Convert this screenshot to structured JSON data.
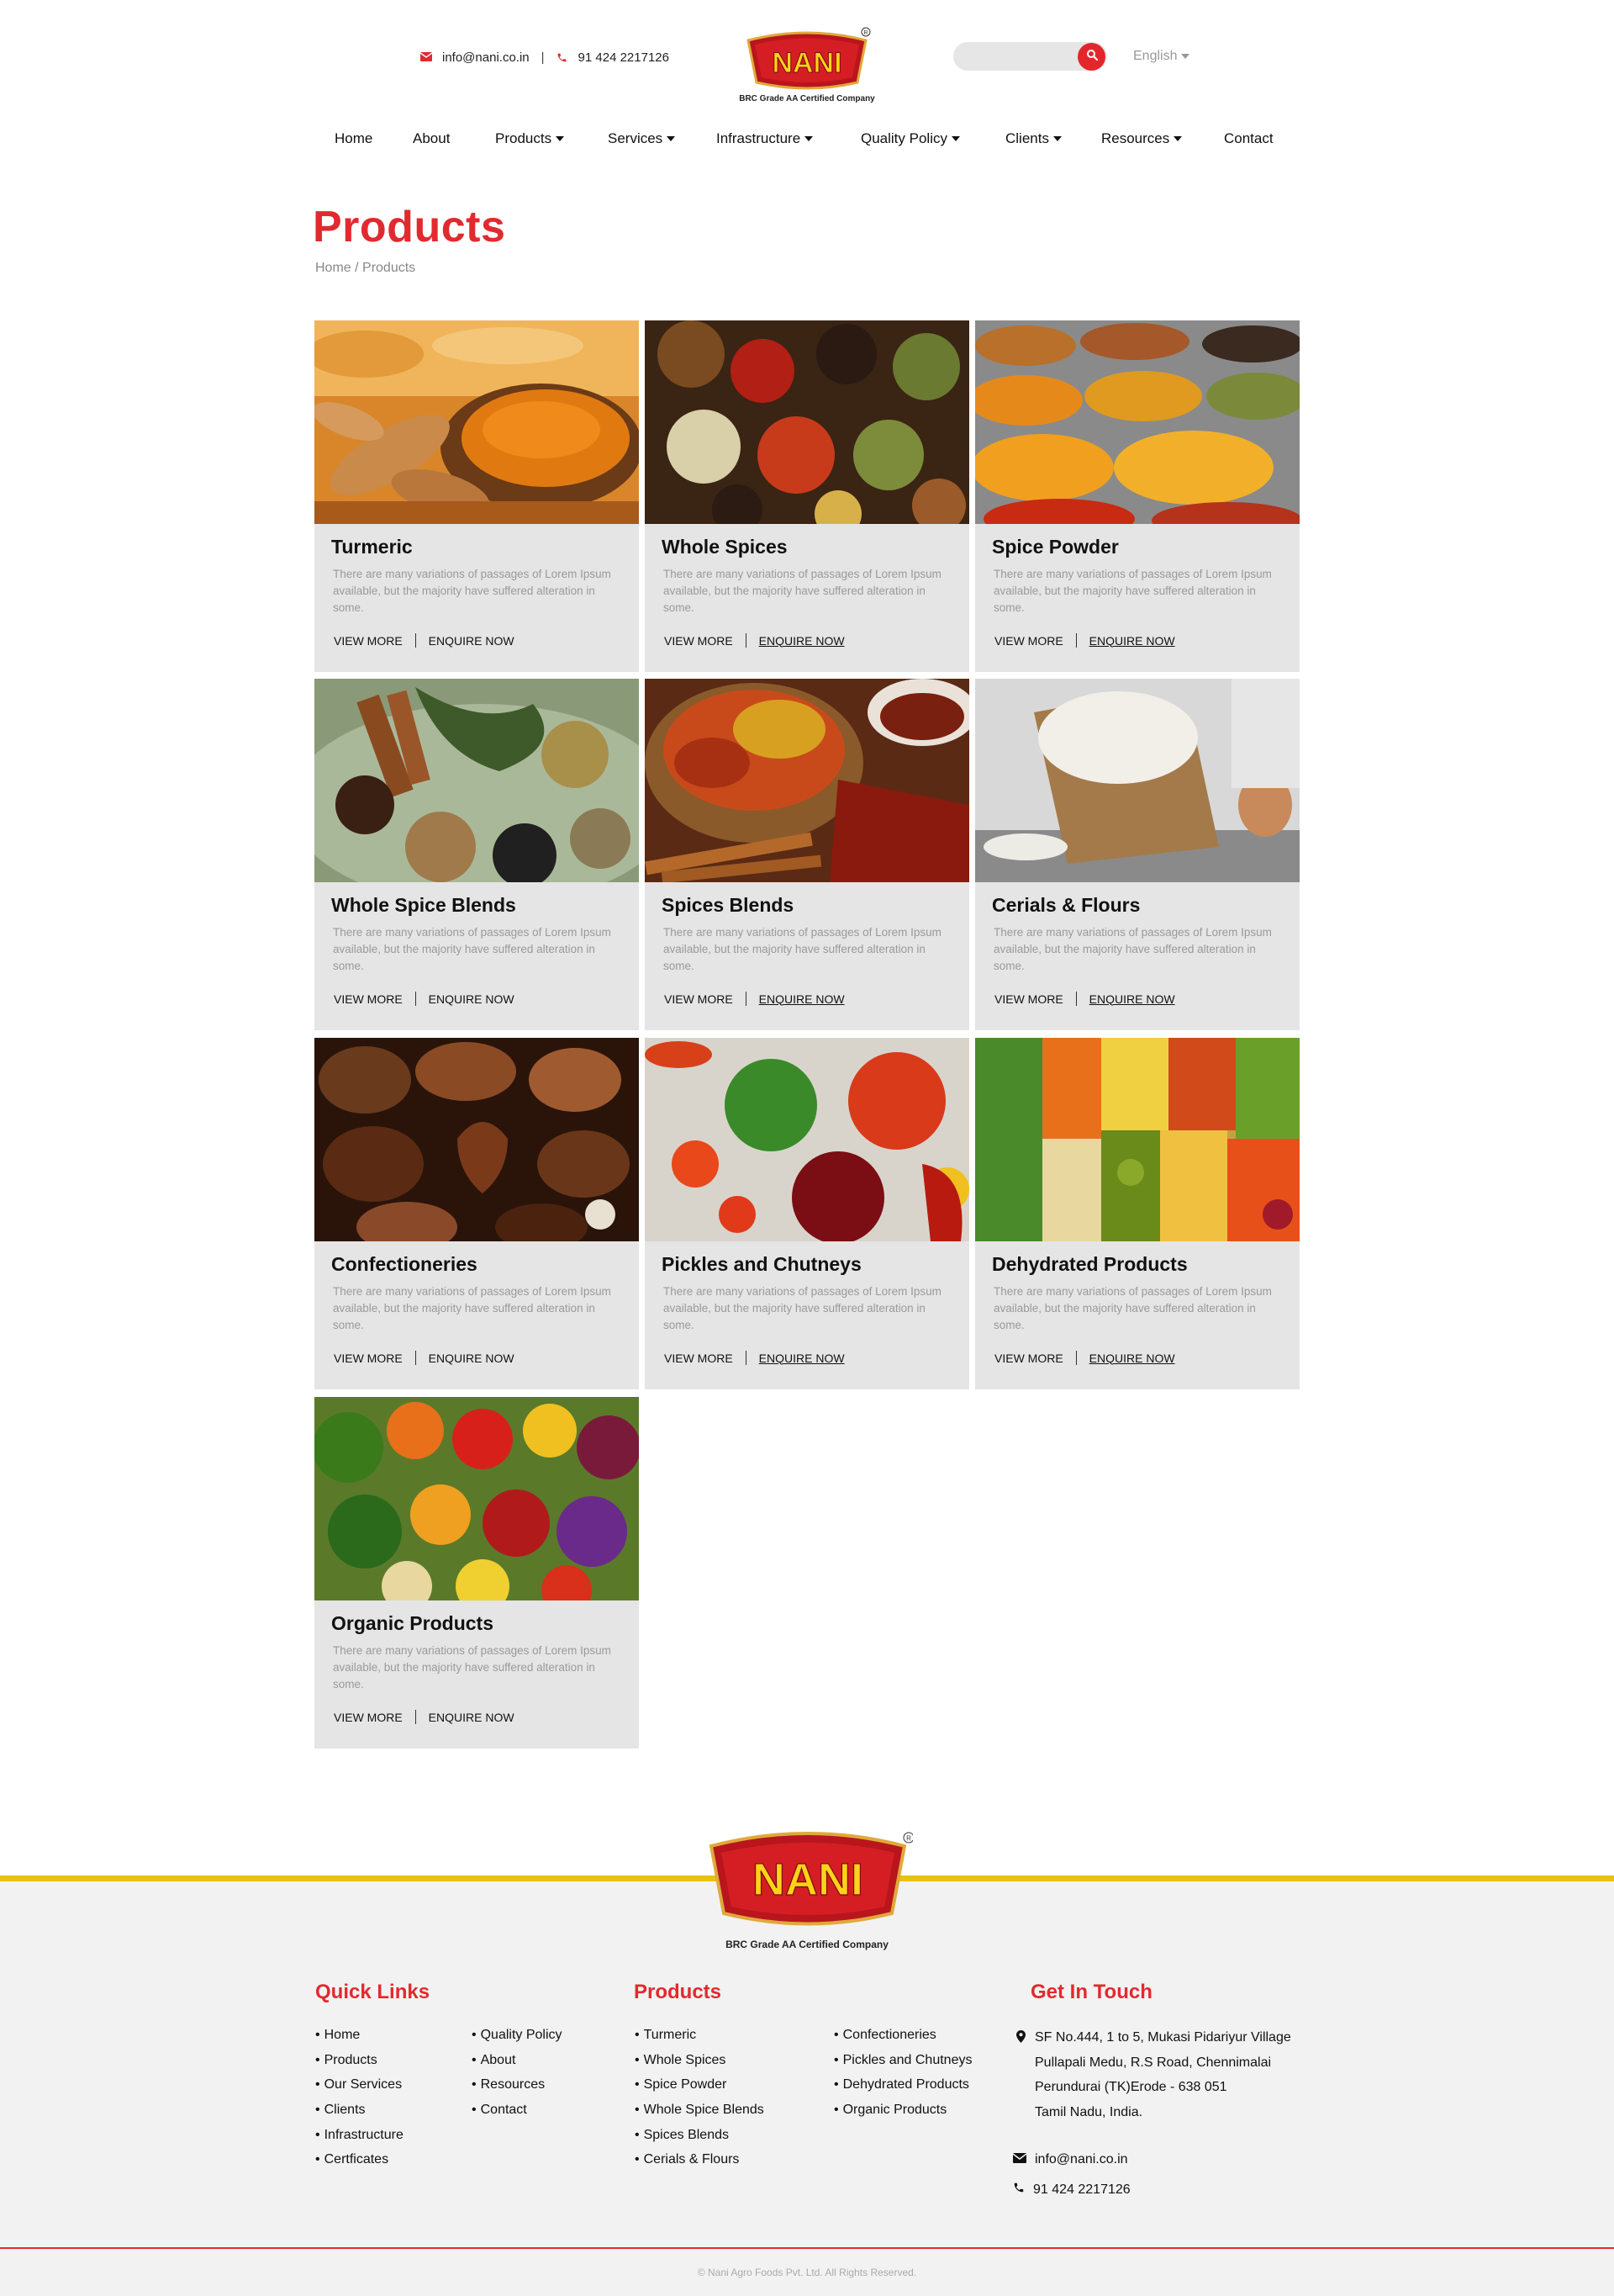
{
  "header": {
    "email": "info@nani.co.in",
    "phone": "91 424 2217126",
    "logo_text": "NANI",
    "logo_caption": "BRC Grade AA Certified Company",
    "search_placeholder": "",
    "language": "English"
  },
  "nav": {
    "items": [
      {
        "label": "Home",
        "dropdown": false
      },
      {
        "label": "About",
        "dropdown": false
      },
      {
        "label": "Products",
        "dropdown": true
      },
      {
        "label": "Services",
        "dropdown": true
      },
      {
        "label": "Infrastructure",
        "dropdown": true
      },
      {
        "label": "Quality Policy",
        "dropdown": true
      },
      {
        "label": "Clients",
        "dropdown": true
      },
      {
        "label": "Resources",
        "dropdown": true
      },
      {
        "label": "Contact",
        "dropdown": false
      }
    ]
  },
  "page": {
    "title": "Products",
    "breadcrumb": "Home / Products"
  },
  "products": {
    "view_more_label": "VIEW MORE",
    "enquire_label": "ENQUIRE NOW",
    "items": [
      {
        "title": "Turmeric",
        "desc": "There are many variations of passages of Lorem Ipsum available, but the majority have suffered alteration in some.",
        "image": "turmeric-photo"
      },
      {
        "title": "Whole Spices",
        "desc": "There are many variations of passages of Lorem Ipsum available, but the majority have suffered alteration in some.",
        "image": "whole-spices-photo"
      },
      {
        "title": "Spice Powder",
        "desc": "There are many variations of passages of Lorem Ipsum available, but the majority have suffered alteration in some.",
        "image": "spice-powder-photo"
      },
      {
        "title": "Whole Spice Blends",
        "desc": "There are many variations of passages of Lorem Ipsum available, but the majority have suffered alteration in some.",
        "image": "whole-spice-blends-photo"
      },
      {
        "title": "Spices Blends",
        "desc": "There are many variations of passages of Lorem Ipsum available, but the majority have suffered alteration in some.",
        "image": "spices-blends-photo"
      },
      {
        "title": "Cerials & Flours",
        "desc": "There are many variations of passages of Lorem Ipsum available, but the majority have suffered alteration in some.",
        "image": "flour-sack-photo"
      },
      {
        "title": "Confectioneries",
        "desc": "There are many variations of passages of Lorem Ipsum available, but the majority have suffered alteration in some.",
        "image": "chocolates-photo"
      },
      {
        "title": "Pickles and Chutneys",
        "desc": "There are many variations of passages of Lorem Ipsum available, but the majority have suffered alteration in some.",
        "image": "pickles-jars-photo"
      },
      {
        "title": "Dehydrated Products",
        "desc": "There are many variations of passages of Lorem Ipsum available, but the majority have suffered alteration in some.",
        "image": "dried-fruits-photo"
      },
      {
        "title": "Organic Products",
        "desc": "There are many variations of passages of Lorem Ipsum available, but the majority have suffered alteration in some.",
        "image": "vegetables-photo"
      }
    ]
  },
  "footer": {
    "logo_text": "NANI",
    "logo_caption": "BRC Grade AA Certified Company",
    "quick_links_title": "Quick Links",
    "quick_links_col1": [
      "Home",
      "Products",
      "Our Services",
      "Clients",
      "Infrastructure",
      "Certficates"
    ],
    "quick_links_col2": [
      "Quality Policy",
      "About",
      "Resources",
      "Contact"
    ],
    "products_title": "Products",
    "products_col1": [
      "Turmeric",
      "Whole Spices",
      "Spice Powder",
      "Whole Spice Blends",
      "Spices Blends",
      "Cerials & Flours"
    ],
    "products_col2": [
      "Confectioneries",
      "Pickles and Chutneys",
      "Dehydrated Products",
      "Organic Products"
    ],
    "get_in_touch_title": "Get In Touch",
    "address_lines": [
      "SF No.444, 1 to 5, Mukasi Pidariyur Village",
      "Pullapali Medu, R.S Road, Chennimalai",
      "Perundurai (TK)Erode - 638 051",
      "Tamil Nadu, India."
    ],
    "email": "info@nani.co.in",
    "phone": "91 424 2217126",
    "copyright": "© Nani Agro Foods Pvt. Ltd. All Rights Reserved."
  },
  "colors": {
    "brand_red": "#e12a2f",
    "brand_yellow": "#e9c10f",
    "card_bg": "#e5e5e5",
    "footer_bg": "#f2f2f2"
  }
}
